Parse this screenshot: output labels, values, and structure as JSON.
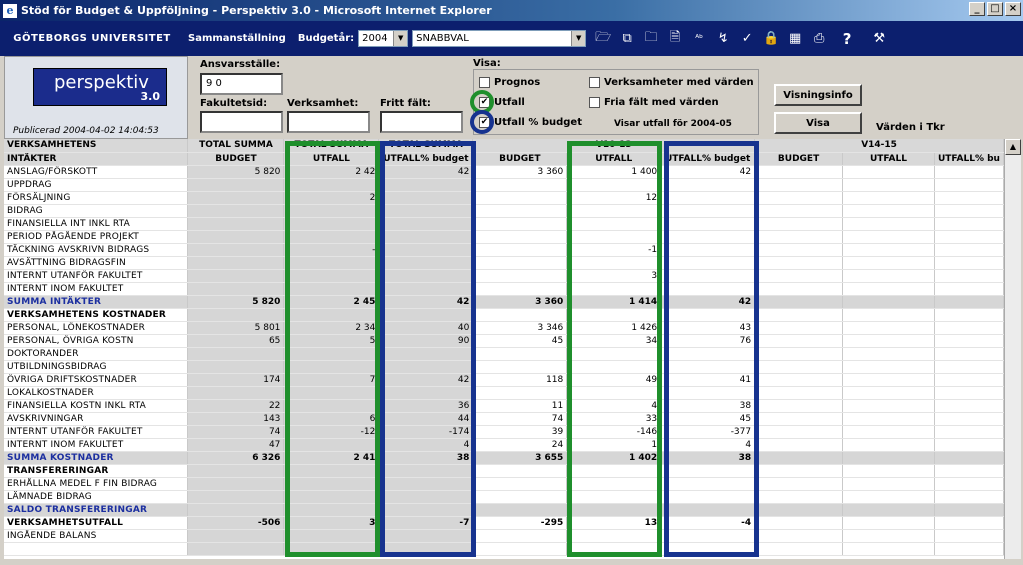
{
  "window": {
    "title": "Stöd för Budget & Uppföljning - Perspektiv 3.0 - Microsoft Internet Explorer"
  },
  "appbar": {
    "university": "GÖTEBORGS UNIVERSITET",
    "sammanstallning_label": "Sammanställning",
    "budgetar_label": "Budgetår:",
    "budgetar_value": "2004",
    "snabbval_value": "SNABBVAL",
    "toolbar_icons": [
      "open-folder-icon",
      "copy-icon",
      "folder-icon",
      "document-icon",
      "abc-icon",
      "sort-icon",
      "checkmark-icon",
      "lock-icon",
      "grid-icon",
      "print-icon",
      "help-icon",
      "wrench-icon"
    ]
  },
  "header": {
    "logo_text": "perspektiv",
    "logo_version": "3.0",
    "published": "Publicerad 2004-04-02 14:04:53",
    "ansvarsstalle_label": "Ansvarsställe:",
    "ansvarsstalle_value": "9 0",
    "fakultetsid_label": "Fakultetsid:",
    "verksamhet_label": "Verksamhet:",
    "fritt_falt_label": "Fritt fält:",
    "visa_label": "Visa:",
    "checkboxes": {
      "prognos": "Prognos",
      "utfall": "Utfall",
      "utfall_pct": "Utfall % budget",
      "verksamheter": "Verksamheter med värden",
      "fria_falt": "Fria fält med värden"
    },
    "visar_utfall": "Visar utfall för 2004-05",
    "visningsinfo_button": "Visningsinfo",
    "visa_button": "Visa",
    "varden_note": "Värden i Tkr"
  },
  "table": {
    "group_headers": [
      "TOTAL SUMMA",
      "TOTAL SUMMA",
      "TOTAL SUMMA",
      "V10-13",
      "V14-15"
    ],
    "corner": [
      "VERKSAMHETENS",
      "INTÄKTER"
    ],
    "col_headers": [
      "BUDGET",
      "UTFALL",
      "UTFALL% budget",
      "BUDGET",
      "UTFALL",
      "UTFALL% budget",
      "BUDGET",
      "UTFALL",
      "UTFALL% bu"
    ],
    "rows": [
      {
        "label": "ANSLAG/FÖRSKOTT",
        "v": [
          "5 820",
          "2 42",
          "42",
          "3 360",
          "1 400",
          "42",
          "",
          "",
          ""
        ]
      },
      {
        "label": "UPPDRAG",
        "v": [
          "",
          "",
          "",
          "",
          "",
          "",
          "",
          "",
          ""
        ]
      },
      {
        "label": "FÖRSÄLJNING",
        "v": [
          "",
          "2",
          "",
          "",
          "12",
          "",
          "",
          "",
          ""
        ]
      },
      {
        "label": "BIDRAG",
        "v": [
          "",
          "",
          "",
          "",
          "",
          "",
          "",
          "",
          ""
        ]
      },
      {
        "label": "FINANSIELLA INT INKL RTA",
        "v": [
          "",
          "",
          "",
          "",
          "",
          "",
          "",
          "",
          ""
        ]
      },
      {
        "label": "PERIOD PÅGÅENDE PROJEKT",
        "v": [
          "",
          "",
          "",
          "",
          "",
          "",
          "",
          "",
          ""
        ]
      },
      {
        "label": "TÄCKNING AVSKRIVN BIDRAGS",
        "v": [
          "",
          "-",
          "",
          "",
          "-1",
          "",
          "",
          "",
          ""
        ]
      },
      {
        "label": "AVSÄTTNING BIDRAGSFIN",
        "v": [
          "",
          "",
          "",
          "",
          "",
          "",
          "",
          "",
          ""
        ]
      },
      {
        "label": "INTERNT UTANFÖR FAKULTET",
        "v": [
          "",
          "",
          "",
          "",
          "3",
          "",
          "",
          "",
          ""
        ]
      },
      {
        "label": "INTERNT INOM FAKULTET",
        "v": [
          "",
          "",
          "",
          "",
          "",
          "",
          "",
          "",
          ""
        ]
      },
      {
        "label": "SUMMA INTÄKTER",
        "type": "sum",
        "v": [
          "5 820",
          "2 45",
          "42",
          "3 360",
          "1 414",
          "42",
          "",
          "",
          ""
        ]
      },
      {
        "label": "VERKSAMHETENS KOSTNADER",
        "type": "bold",
        "v": [
          "",
          "",
          "",
          "",
          "",
          "",
          "",
          "",
          ""
        ]
      },
      {
        "label": "PERSONAL, LÖNEKOSTNADER",
        "v": [
          "5 801",
          "2 34",
          "40",
          "3 346",
          "1 426",
          "43",
          "",
          "",
          ""
        ]
      },
      {
        "label": "PERSONAL, ÖVRIGA KOSTN",
        "v": [
          "65",
          "5",
          "90",
          "45",
          "34",
          "76",
          "",
          "",
          ""
        ]
      },
      {
        "label": "DOKTORANDER",
        "v": [
          "",
          "",
          "",
          "",
          "",
          "",
          "",
          "",
          ""
        ]
      },
      {
        "label": "UTBILDNINGSBIDRAG",
        "v": [
          "",
          "",
          "",
          "",
          "",
          "",
          "",
          "",
          ""
        ]
      },
      {
        "label": "ÖVRIGA DRIFTSKOSTNADER",
        "v": [
          "174",
          "7",
          "42",
          "118",
          "49",
          "41",
          "",
          "",
          ""
        ]
      },
      {
        "label": "LOKALKOSTNADER",
        "v": [
          "",
          "",
          "",
          "",
          "",
          "",
          "",
          "",
          ""
        ]
      },
      {
        "label": "FINANSIELLA KOSTN INKL RTA",
        "v": [
          "22",
          "",
          "36",
          "11",
          "4",
          "38",
          "",
          "",
          ""
        ]
      },
      {
        "label": "AVSKRIVNINGAR",
        "v": [
          "143",
          "6",
          "44",
          "74",
          "33",
          "45",
          "",
          "",
          ""
        ]
      },
      {
        "label": "INTERNT UTANFÖR FAKULTET",
        "v": [
          "74",
          "-12",
          "-174",
          "39",
          "-146",
          "-377",
          "",
          "",
          ""
        ]
      },
      {
        "label": "INTERNT INOM FAKULTET",
        "v": [
          "47",
          "",
          "4",
          "24",
          "1",
          "4",
          "",
          "",
          ""
        ]
      },
      {
        "label": "SUMMA KOSTNADER",
        "type": "sum",
        "v": [
          "6 326",
          "2 41",
          "38",
          "3 655",
          "1 402",
          "38",
          "",
          "",
          ""
        ]
      },
      {
        "label": "TRANSFERERINGAR",
        "type": "bold",
        "v": [
          "",
          "",
          "",
          "",
          "",
          "",
          "",
          "",
          ""
        ]
      },
      {
        "label": "ERHÅLLNA MEDEL F FIN BIDRAG",
        "v": [
          "",
          "",
          "",
          "",
          "",
          "",
          "",
          "",
          ""
        ]
      },
      {
        "label": "LÄMNADE BIDRAG",
        "v": [
          "",
          "",
          "",
          "",
          "",
          "",
          "",
          "",
          ""
        ]
      },
      {
        "label": "SALDO TRANSFERERINGAR",
        "type": "sum",
        "v": [
          "",
          "",
          "",
          "",
          "",
          "",
          "",
          "",
          ""
        ]
      },
      {
        "label": "VERKSAMHETSUTFALL",
        "type": "bold",
        "v": [
          "-506",
          "3",
          "-7",
          "-295",
          "13",
          "-4",
          "",
          "",
          ""
        ]
      },
      {
        "label": "INGÅENDE BALANS",
        "v": [
          "",
          "",
          "",
          "",
          "",
          "",
          "",
          "",
          ""
        ]
      },
      {
        "label": "",
        "v": [
          "",
          "",
          "",
          "",
          "",
          "",
          "",
          "",
          ""
        ]
      }
    ]
  }
}
